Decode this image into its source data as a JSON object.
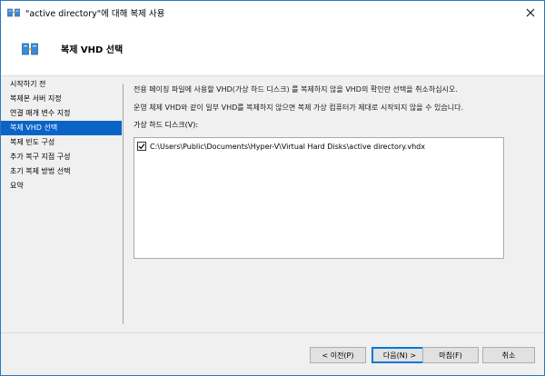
{
  "window": {
    "title": "\"active directory\"에 대해 복제 사용"
  },
  "header": {
    "title": "복제 VHD 선택"
  },
  "sidebar": {
    "items": [
      {
        "label": "시작하기 전",
        "active": false
      },
      {
        "label": "복제본 서버 지정",
        "active": false
      },
      {
        "label": "연결 매개 변수 지정",
        "active": false
      },
      {
        "label": "복제 VHD 선택",
        "active": true
      },
      {
        "label": "복제 빈도 구성",
        "active": false
      },
      {
        "label": "추가 복구 지점 구성",
        "active": false
      },
      {
        "label": "초기 복제 방법 선택",
        "active": false
      },
      {
        "label": "요약",
        "active": false
      }
    ]
  },
  "main": {
    "description_1": "전용 페이징 파일에 사용할 VHD(가상 하드 디스크) 를 복제하지 않을 VHD의 확인란 선택을 취소하십시오.",
    "description_2": "운영 체제 VHD와 같이 일부 VHD를 복제하지 않으면 복제 가상 컴퓨터가 제대로 시작되지 않을 수 있습니다.",
    "list_label": "가상 하드 디스크(V):",
    "vhds": [
      {
        "path": "C:\\Users\\Public\\Documents\\Hyper-V\\Virtual Hard Disks\\active directory.vhdx",
        "checked": true
      }
    ]
  },
  "footer": {
    "prev_label": "< 이전(P)",
    "next_label": "다음(N) >",
    "finish_label": "마침(F)",
    "cancel_label": "취소"
  },
  "colors": {
    "accent": "#0a64c8",
    "window_border": "#2b79c2"
  },
  "icons": {
    "title": "hyperv-replication-icon",
    "header": "hyperv-replication-icon",
    "close": "close-icon",
    "checkbox": "checkmark-icon"
  }
}
